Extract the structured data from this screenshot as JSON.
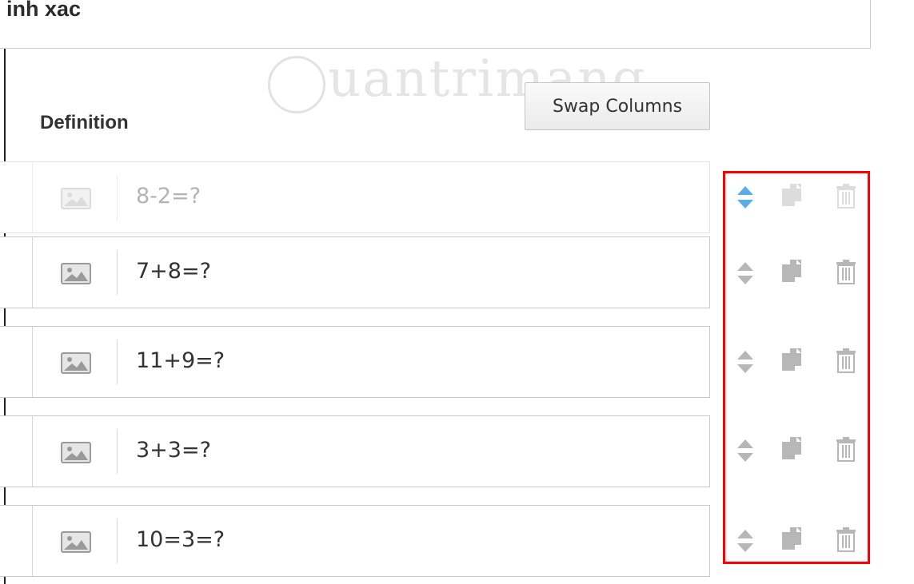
{
  "title_field": {
    "value": "inh xac"
  },
  "column_header": "Definition",
  "swap_button": {
    "label": "Swap Columns"
  },
  "watermark": {
    "text": "uantrimang"
  },
  "rows": [
    {
      "term": "8-2=?",
      "state": "dragging"
    },
    {
      "term": "7+8=?",
      "state": "normal"
    },
    {
      "term": "11+9=?",
      "state": "normal"
    },
    {
      "term": "3+3=?",
      "state": "normal"
    },
    {
      "term": "10=3=?",
      "state": "normal"
    }
  ],
  "row_actions": [
    "sort-handle-icon",
    "copy-icon",
    "trash-icon"
  ],
  "colors": {
    "highlight_border": "#ff0000",
    "active_sort": "#5aaee8",
    "icon_gray": "#b7b7b7",
    "ghost_icon": "#dcdcdc"
  }
}
